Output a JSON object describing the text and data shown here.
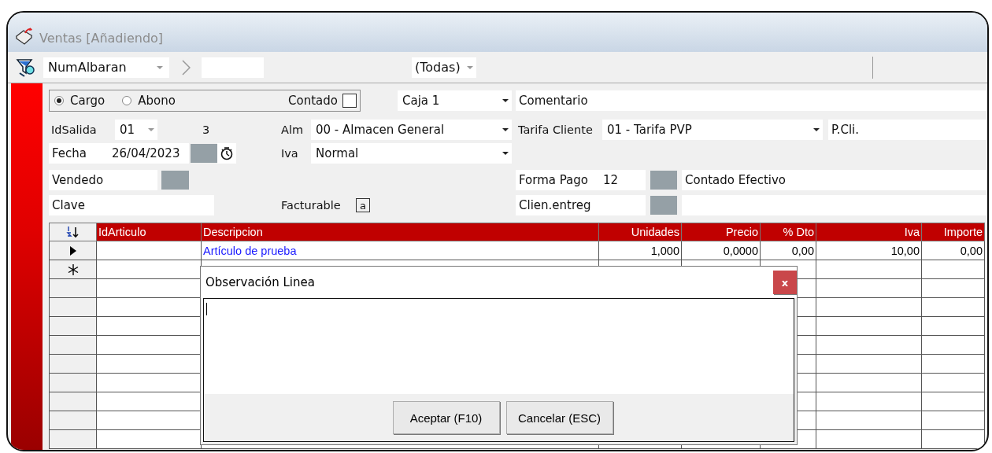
{
  "window": {
    "title": "Ventas [Añadiendo]"
  },
  "toolbar": {
    "search_field": "NumAlbaran",
    "filter": "(Todas)"
  },
  "form": {
    "tipo": [
      {
        "label": "Cargo",
        "selected": true
      },
      {
        "label": "Abono",
        "selected": false
      }
    ],
    "contado": {
      "label": "Contado",
      "checked": false
    },
    "caja": "Caja 1",
    "comentario": {
      "placeholder": "Comentario"
    },
    "id_salida": {
      "label": "IdSalida",
      "value": "01",
      "number": "3"
    },
    "alm": {
      "label": "Alm",
      "value": "00 - Almacen General"
    },
    "tarifa": {
      "label": "Tarifa Cliente",
      "value": "01 - Tarifa PVP"
    },
    "pcli": {
      "placeholder": "P.Cli."
    },
    "fecha": {
      "label": "Fecha",
      "value": "26/04/2023"
    },
    "iva": {
      "label": "Iva",
      "value": "Normal"
    },
    "vendedor": {
      "label": "Vendedo"
    },
    "forma_pago": {
      "label": "Forma Pago",
      "code": "12",
      "description": "Contado Efectivo"
    },
    "clave": {
      "label": "Clave"
    },
    "facturable": {
      "label": "Facturable",
      "value": "a"
    },
    "cliente_entrega": {
      "label": "Clien.entreg"
    }
  },
  "grid": {
    "columns": [
      {
        "label": "IdArticulo"
      },
      {
        "label": "Descripcion"
      },
      {
        "label": "Unidades"
      },
      {
        "label": "Precio"
      },
      {
        "label": "% Dto"
      },
      {
        "label": "Iva"
      },
      {
        "label": "Importe"
      }
    ],
    "rows": [
      {
        "kind": "current",
        "cells": [
          null,
          "Artículo de prueba",
          "1,000",
          "0,0000",
          "0,00",
          "10,00",
          "0,00"
        ]
      },
      {
        "kind": "new",
        "cells": [
          null,
          null,
          null,
          null,
          null,
          null,
          null
        ]
      }
    ]
  },
  "dialog": {
    "title": "Observación Linea",
    "close": "x",
    "buttons": [
      "Aceptar (F10)",
      "Cancelar (ESC)"
    ]
  }
}
